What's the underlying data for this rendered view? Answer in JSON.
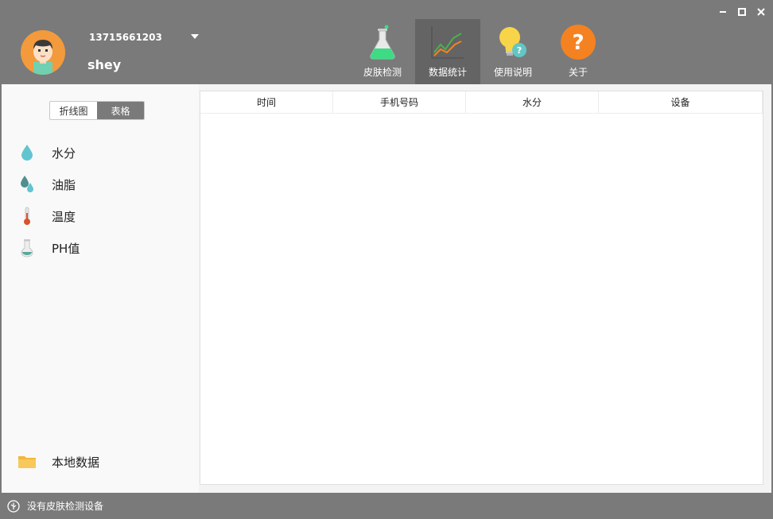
{
  "user": {
    "phone": "13715661203",
    "name": "shey"
  },
  "nav": [
    {
      "label": "皮肤检测",
      "icon": "flask-icon"
    },
    {
      "label": "数据统计",
      "icon": "line-chart-icon",
      "active": true
    },
    {
      "label": "使用说明",
      "icon": "lightbulb-icon"
    },
    {
      "label": "关于",
      "icon": "question-icon"
    }
  ],
  "view_toggle": {
    "line_chart": "折线图",
    "table": "表格",
    "active": "table"
  },
  "metrics": [
    {
      "label": "水分",
      "icon": "water-drop-icon"
    },
    {
      "label": "油脂",
      "icon": "oil-drops-icon"
    },
    {
      "label": "温度",
      "icon": "thermometer-icon"
    },
    {
      "label": "PH值",
      "icon": "test-tube-icon"
    }
  ],
  "local_data": {
    "label": "本地数据",
    "icon": "folder-icon"
  },
  "table": {
    "columns": [
      "时间",
      "手机号码",
      "水分",
      "设备"
    ],
    "rows": []
  },
  "status": {
    "text": "没有皮肤检测设备",
    "icon": "usb-icon"
  },
  "colors": {
    "chrome": "#7a7a7a",
    "active_tab": "#646464",
    "accent_orange": "#f58220",
    "flask_green": "#3ddc84"
  }
}
